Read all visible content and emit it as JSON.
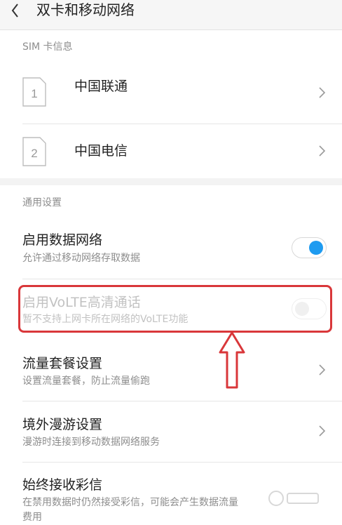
{
  "header": {
    "title": "双卡和移动网络",
    "back_icon": "chevron-left-icon"
  },
  "sim_section": {
    "label": "SIM 卡信息",
    "cards": [
      {
        "slot": "1",
        "name": "中国联通"
      },
      {
        "slot": "2",
        "name": "中国电信"
      }
    ]
  },
  "general_section": {
    "label": "通用设置",
    "mobile_data": {
      "title": "启用数据网络",
      "desc": "允许通过移动网络存取数据",
      "enabled": true
    },
    "volte": {
      "title": "启用VoLTE高清通话",
      "desc": "暂不支持上网卡所在网络的VoLTE功能",
      "enabled": false,
      "disabled": true
    },
    "data_plan": {
      "title": "流量套餐设置",
      "desc": "设置流量套餐，防止流量偷跑"
    },
    "roaming": {
      "title": "境外漫游设置",
      "desc": "漫游时连接到移动数据网络服务"
    },
    "mms": {
      "title": "始终接收彩信",
      "desc": "在禁用数据时仍然接受彩信，可能会产生数据流量",
      "desc_line2": "费用"
    }
  },
  "annotation": {
    "color": "#d9373a",
    "shape": "up-arrow-icon"
  },
  "colors": {
    "accent": "#1e9bf0",
    "header_bg": "#f6f6f6",
    "gap_bg": "#f3f3f3"
  }
}
